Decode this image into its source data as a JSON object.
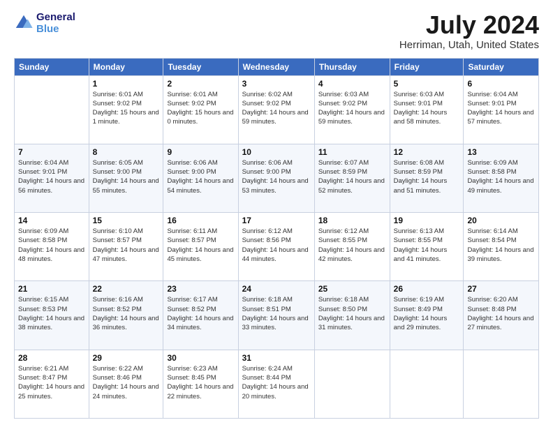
{
  "logo": {
    "line1": "General",
    "line2": "Blue"
  },
  "title": "July 2024",
  "subtitle": "Herriman, Utah, United States",
  "headers": [
    "Sunday",
    "Monday",
    "Tuesday",
    "Wednesday",
    "Thursday",
    "Friday",
    "Saturday"
  ],
  "weeks": [
    [
      {
        "day": "",
        "sunrise": "",
        "sunset": "",
        "daylight": ""
      },
      {
        "day": "1",
        "sunrise": "Sunrise: 6:01 AM",
        "sunset": "Sunset: 9:02 PM",
        "daylight": "Daylight: 15 hours and 1 minute."
      },
      {
        "day": "2",
        "sunrise": "Sunrise: 6:01 AM",
        "sunset": "Sunset: 9:02 PM",
        "daylight": "Daylight: 15 hours and 0 minutes."
      },
      {
        "day": "3",
        "sunrise": "Sunrise: 6:02 AM",
        "sunset": "Sunset: 9:02 PM",
        "daylight": "Daylight: 14 hours and 59 minutes."
      },
      {
        "day": "4",
        "sunrise": "Sunrise: 6:03 AM",
        "sunset": "Sunset: 9:02 PM",
        "daylight": "Daylight: 14 hours and 59 minutes."
      },
      {
        "day": "5",
        "sunrise": "Sunrise: 6:03 AM",
        "sunset": "Sunset: 9:01 PM",
        "daylight": "Daylight: 14 hours and 58 minutes."
      },
      {
        "day": "6",
        "sunrise": "Sunrise: 6:04 AM",
        "sunset": "Sunset: 9:01 PM",
        "daylight": "Daylight: 14 hours and 57 minutes."
      }
    ],
    [
      {
        "day": "7",
        "sunrise": "Sunrise: 6:04 AM",
        "sunset": "Sunset: 9:01 PM",
        "daylight": "Daylight: 14 hours and 56 minutes."
      },
      {
        "day": "8",
        "sunrise": "Sunrise: 6:05 AM",
        "sunset": "Sunset: 9:00 PM",
        "daylight": "Daylight: 14 hours and 55 minutes."
      },
      {
        "day": "9",
        "sunrise": "Sunrise: 6:06 AM",
        "sunset": "Sunset: 9:00 PM",
        "daylight": "Daylight: 14 hours and 54 minutes."
      },
      {
        "day": "10",
        "sunrise": "Sunrise: 6:06 AM",
        "sunset": "Sunset: 9:00 PM",
        "daylight": "Daylight: 14 hours and 53 minutes."
      },
      {
        "day": "11",
        "sunrise": "Sunrise: 6:07 AM",
        "sunset": "Sunset: 8:59 PM",
        "daylight": "Daylight: 14 hours and 52 minutes."
      },
      {
        "day": "12",
        "sunrise": "Sunrise: 6:08 AM",
        "sunset": "Sunset: 8:59 PM",
        "daylight": "Daylight: 14 hours and 51 minutes."
      },
      {
        "day": "13",
        "sunrise": "Sunrise: 6:09 AM",
        "sunset": "Sunset: 8:58 PM",
        "daylight": "Daylight: 14 hours and 49 minutes."
      }
    ],
    [
      {
        "day": "14",
        "sunrise": "Sunrise: 6:09 AM",
        "sunset": "Sunset: 8:58 PM",
        "daylight": "Daylight: 14 hours and 48 minutes."
      },
      {
        "day": "15",
        "sunrise": "Sunrise: 6:10 AM",
        "sunset": "Sunset: 8:57 PM",
        "daylight": "Daylight: 14 hours and 47 minutes."
      },
      {
        "day": "16",
        "sunrise": "Sunrise: 6:11 AM",
        "sunset": "Sunset: 8:57 PM",
        "daylight": "Daylight: 14 hours and 45 minutes."
      },
      {
        "day": "17",
        "sunrise": "Sunrise: 6:12 AM",
        "sunset": "Sunset: 8:56 PM",
        "daylight": "Daylight: 14 hours and 44 minutes."
      },
      {
        "day": "18",
        "sunrise": "Sunrise: 6:12 AM",
        "sunset": "Sunset: 8:55 PM",
        "daylight": "Daylight: 14 hours and 42 minutes."
      },
      {
        "day": "19",
        "sunrise": "Sunrise: 6:13 AM",
        "sunset": "Sunset: 8:55 PM",
        "daylight": "Daylight: 14 hours and 41 minutes."
      },
      {
        "day": "20",
        "sunrise": "Sunrise: 6:14 AM",
        "sunset": "Sunset: 8:54 PM",
        "daylight": "Daylight: 14 hours and 39 minutes."
      }
    ],
    [
      {
        "day": "21",
        "sunrise": "Sunrise: 6:15 AM",
        "sunset": "Sunset: 8:53 PM",
        "daylight": "Daylight: 14 hours and 38 minutes."
      },
      {
        "day": "22",
        "sunrise": "Sunrise: 6:16 AM",
        "sunset": "Sunset: 8:52 PM",
        "daylight": "Daylight: 14 hours and 36 minutes."
      },
      {
        "day": "23",
        "sunrise": "Sunrise: 6:17 AM",
        "sunset": "Sunset: 8:52 PM",
        "daylight": "Daylight: 14 hours and 34 minutes."
      },
      {
        "day": "24",
        "sunrise": "Sunrise: 6:18 AM",
        "sunset": "Sunset: 8:51 PM",
        "daylight": "Daylight: 14 hours and 33 minutes."
      },
      {
        "day": "25",
        "sunrise": "Sunrise: 6:18 AM",
        "sunset": "Sunset: 8:50 PM",
        "daylight": "Daylight: 14 hours and 31 minutes."
      },
      {
        "day": "26",
        "sunrise": "Sunrise: 6:19 AM",
        "sunset": "Sunset: 8:49 PM",
        "daylight": "Daylight: 14 hours and 29 minutes."
      },
      {
        "day": "27",
        "sunrise": "Sunrise: 6:20 AM",
        "sunset": "Sunset: 8:48 PM",
        "daylight": "Daylight: 14 hours and 27 minutes."
      }
    ],
    [
      {
        "day": "28",
        "sunrise": "Sunrise: 6:21 AM",
        "sunset": "Sunset: 8:47 PM",
        "daylight": "Daylight: 14 hours and 25 minutes."
      },
      {
        "day": "29",
        "sunrise": "Sunrise: 6:22 AM",
        "sunset": "Sunset: 8:46 PM",
        "daylight": "Daylight: 14 hours and 24 minutes."
      },
      {
        "day": "30",
        "sunrise": "Sunrise: 6:23 AM",
        "sunset": "Sunset: 8:45 PM",
        "daylight": "Daylight: 14 hours and 22 minutes."
      },
      {
        "day": "31",
        "sunrise": "Sunrise: 6:24 AM",
        "sunset": "Sunset: 8:44 PM",
        "daylight": "Daylight: 14 hours and 20 minutes."
      },
      {
        "day": "",
        "sunrise": "",
        "sunset": "",
        "daylight": ""
      },
      {
        "day": "",
        "sunrise": "",
        "sunset": "",
        "daylight": ""
      },
      {
        "day": "",
        "sunrise": "",
        "sunset": "",
        "daylight": ""
      }
    ]
  ]
}
